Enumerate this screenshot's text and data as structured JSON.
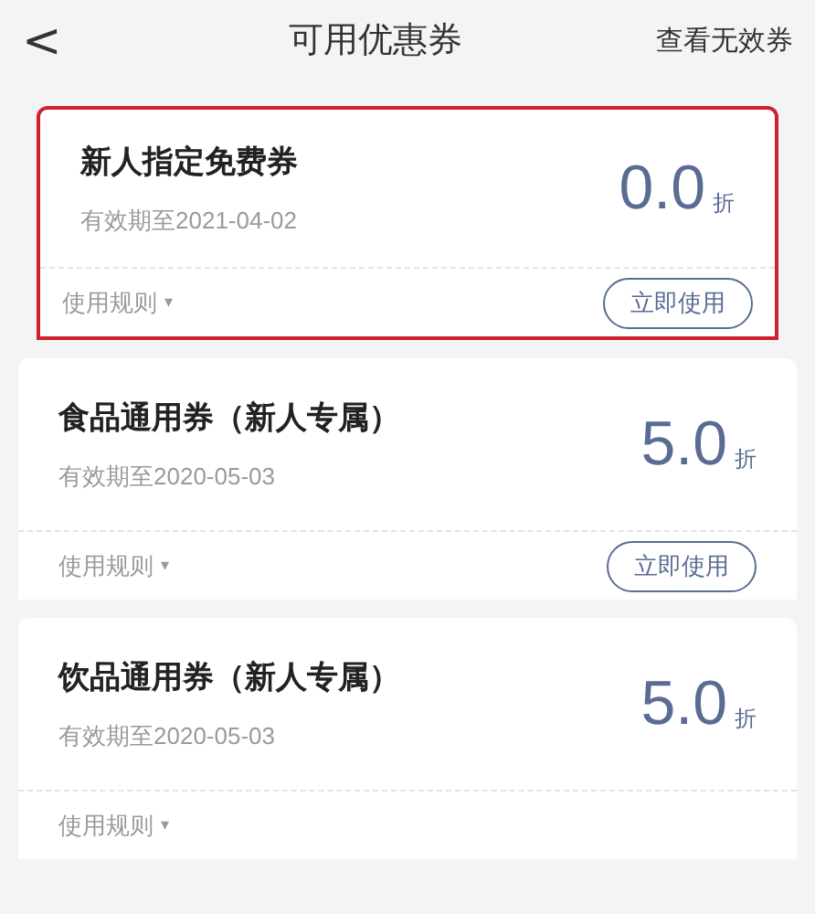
{
  "header": {
    "back": "<",
    "title": "可用优惠券",
    "action": "查看无效券"
  },
  "coupons": [
    {
      "name": "新人指定免费券",
      "validity": "有效期至2021-04-02",
      "value": "0.0",
      "unit": "折",
      "rules": "使用规则",
      "rules_arrow": "▾",
      "button": "立即使用",
      "highlighted": true
    },
    {
      "name": "食品通用券（新人专属）",
      "validity": "有效期至2020-05-03",
      "value": "5.0",
      "unit": "折",
      "rules": "使用规则",
      "rules_arrow": "▾",
      "button": "立即使用",
      "highlighted": false
    },
    {
      "name": "饮品通用券（新人专属）",
      "validity": "有效期至2020-05-03",
      "value": "5.0",
      "unit": "折",
      "rules": "使用规则",
      "rules_arrow": "▾",
      "highlighted": false
    }
  ]
}
